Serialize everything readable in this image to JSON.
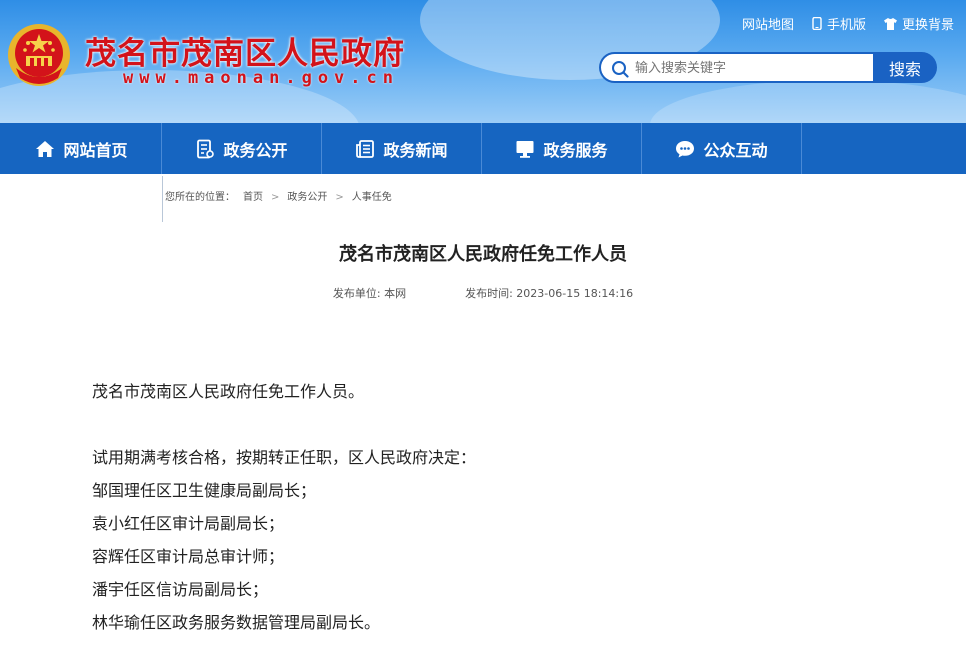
{
  "header": {
    "site_title": "茂名市茂南区人民政府",
    "site_url": "www.maonan.gov.cn",
    "top_links": [
      {
        "label": "网站地图",
        "icon": "none"
      },
      {
        "label": "手机版",
        "icon": "mobile-icon"
      },
      {
        "label": "更换背景",
        "icon": "shirt-icon"
      }
    ],
    "search": {
      "placeholder": "输入搜索关键字",
      "button_label": "搜索"
    },
    "colors": {
      "title_red": "#d3131a",
      "nav_blue": "#1665c1"
    }
  },
  "nav": {
    "items": [
      {
        "label": "网站首页",
        "icon": "home-icon"
      },
      {
        "label": "政务公开",
        "icon": "document-icon"
      },
      {
        "label": "政务新闻",
        "icon": "news-icon"
      },
      {
        "label": "政务服务",
        "icon": "monitor-icon"
      },
      {
        "label": "公众互动",
        "icon": "chat-icon"
      }
    ]
  },
  "breadcrumb": {
    "prefix": "您所在的位置：",
    "items": [
      "首页",
      "政务公开",
      "人事任免"
    ]
  },
  "article": {
    "title": "茂名市茂南区人民政府任免工作人员",
    "publisher_label": "发布单位:",
    "publisher": "本网",
    "time_label": "发布时间:",
    "time": "2023-06-15 18:14:16",
    "intro": "茂名市茂南区人民政府任免工作人员。",
    "lead": "试用期满考核合格，按期转正任职，区人民政府决定：",
    "lines": [
      "邹国理任区卫生健康局副局长；",
      "袁小红任区审计局副局长；",
      "容辉任区审计局总审计师；",
      "潘宇任区信访局副局长；",
      "林华瑜任区政务服务数据管理局副局长。"
    ]
  }
}
